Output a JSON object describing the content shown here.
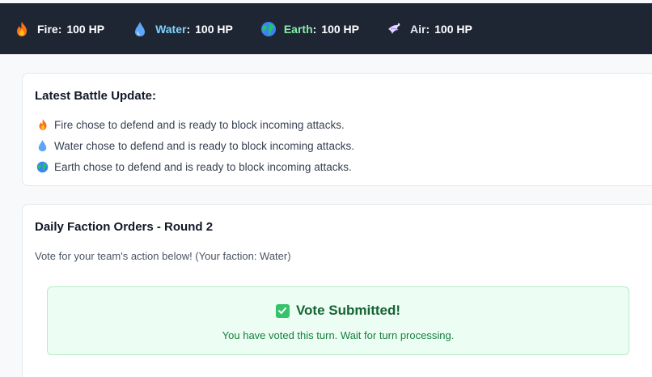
{
  "factions": [
    {
      "icon": "fire-icon",
      "name": "Fire",
      "hp": "100 HP",
      "color": "#ffffff"
    },
    {
      "icon": "water-drop-icon",
      "name": "Water",
      "hp": "100 HP",
      "color": "#7dd3fc"
    },
    {
      "icon": "earth-globe-icon",
      "name": "Earth",
      "hp": "100 HP",
      "color": "#86efac"
    },
    {
      "icon": "wind-icon",
      "name": "Air",
      "hp": "100 HP",
      "color": "#e5e7eb"
    }
  ],
  "battle_update": {
    "title": "Latest Battle Update:",
    "items": [
      {
        "icon": "fire-icon",
        "text": "Fire chose to defend and is ready to block incoming attacks."
      },
      {
        "icon": "water-drop-icon",
        "text": "Water chose to defend and is ready to block incoming attacks."
      },
      {
        "icon": "earth-globe-icon",
        "text": "Earth chose to defend and is ready to block incoming attacks."
      }
    ]
  },
  "orders": {
    "title": "Daily Faction Orders - Round 2",
    "subtitle": "Vote for your team's action below! (Your faction: Water)",
    "vote_title": "Vote Submitted!",
    "vote_message": "You have voted this turn. Wait for turn processing."
  },
  "colors": {
    "topbar": "#1e2634",
    "success_bg": "#ecfdf3",
    "success_text": "#166534"
  }
}
